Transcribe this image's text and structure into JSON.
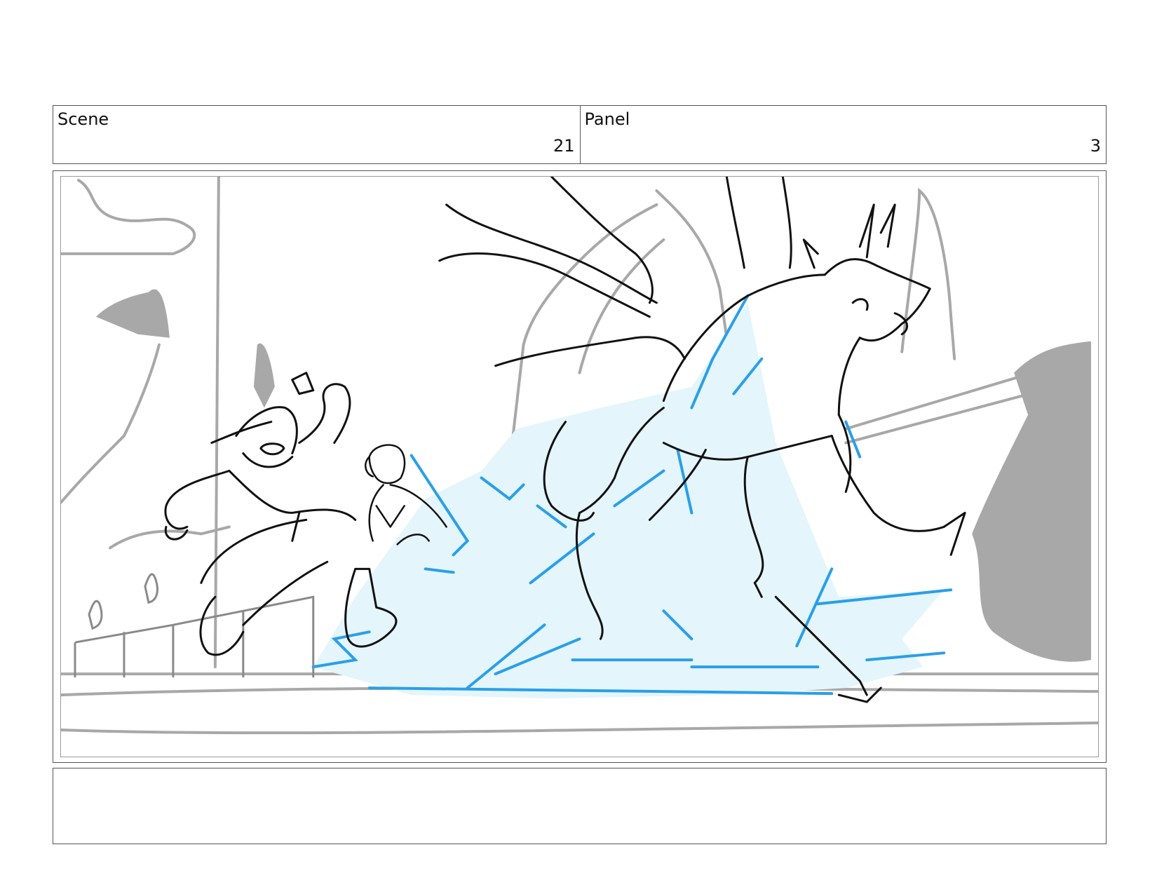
{
  "header": {
    "scene_label": "Scene",
    "scene_number": "21",
    "panel_label": "Panel",
    "panel_number": "3"
  },
  "colors": {
    "frame": "#555555",
    "sketch_line": "#111111",
    "background_gray": "#a8a8a8",
    "effect_blue": "#2a9fe8",
    "effect_fill": "#e4f5fc"
  },
  "notes": {
    "dialogue": ""
  }
}
